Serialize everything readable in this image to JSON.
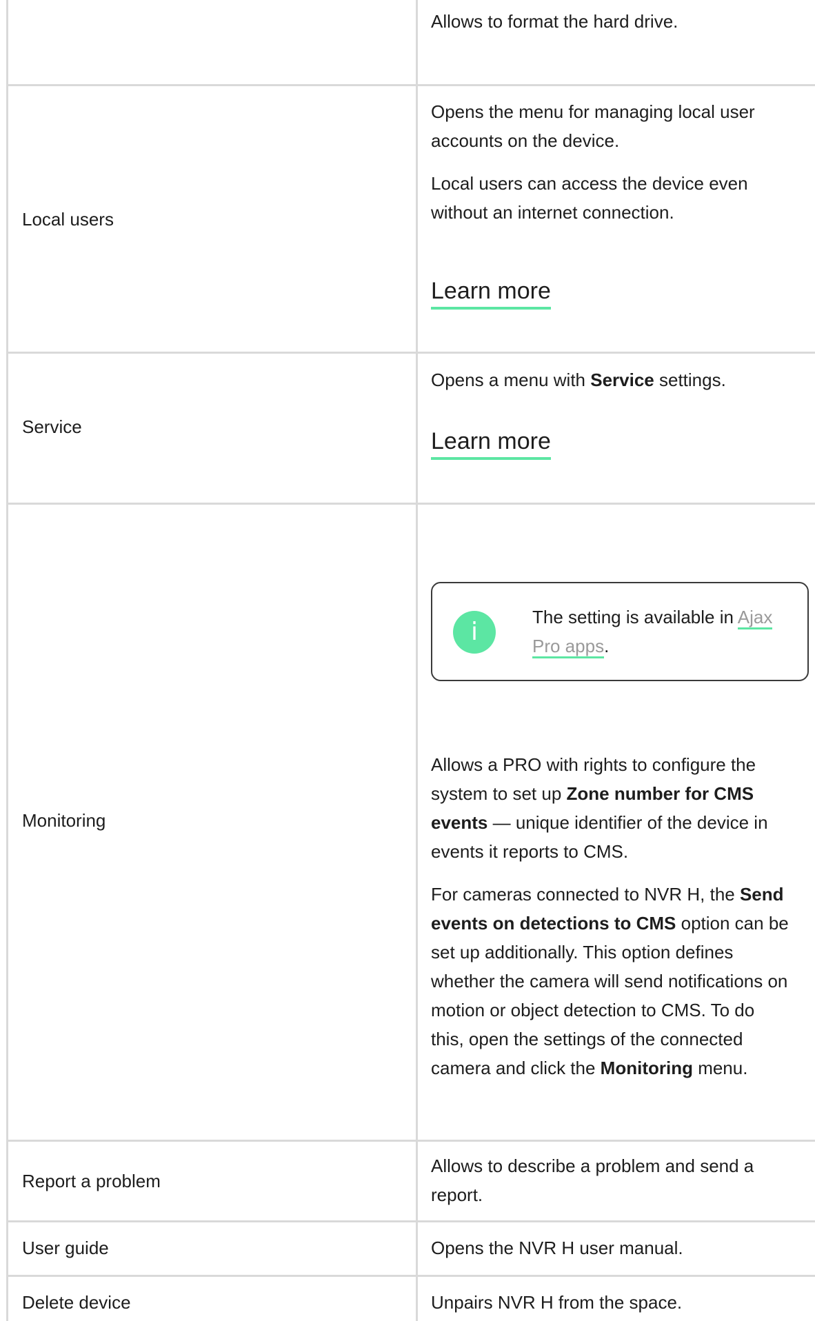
{
  "rows": {
    "format_drive": {
      "label": "",
      "description": "Allows to format the hard drive."
    },
    "local_users": {
      "label": "Local users",
      "paragraph_1": "Opens the menu for managing local user accounts on the device.",
      "paragraph_2": "Local users can access the device even without an internet connection.",
      "learn_more": "Learn more"
    },
    "service": {
      "label": "Service",
      "desc_before": "Opens a menu with ",
      "desc_bold": "Service",
      "desc_after": " settings.",
      "learn_more": "Learn more"
    },
    "monitoring": {
      "label": "Monitoring",
      "notice": {
        "icon": "info-icon",
        "icon_glyph": "i",
        "text_before": "The setting is available in ",
        "link": "Ajax Pro apps",
        "text_after": "."
      },
      "p1_before": "Allows a PRO with rights to configure the system to set up ",
      "p1_bold": "Zone number for CMS events",
      "p1_after": " — unique identifier of the device in events it reports to CMS.",
      "p2_before": "For cameras connected to NVR H, the ",
      "p2_bold1": "Send events on detections to CMS",
      "p2_mid": " option can be set up additionally. This option defines whether the camera will send notifications on motion or object detection to CMS. To do this, open the settings of the connected camera and click the ",
      "p2_bold2": "Monitoring",
      "p2_after": " menu."
    },
    "report_problem": {
      "label": "Report a problem",
      "description": "Allows to describe a problem and send a report."
    },
    "user_guide": {
      "label": "User guide",
      "description": "Opens the NVR H user manual."
    },
    "delete_device": {
      "label": "Delete device",
      "description": "Unpairs NVR H from the space."
    }
  },
  "colors": {
    "accent": "#5ce6a3",
    "border": "#d9d9d9",
    "text": "#1d1d1d",
    "link_muted": "#9a9a9a"
  }
}
